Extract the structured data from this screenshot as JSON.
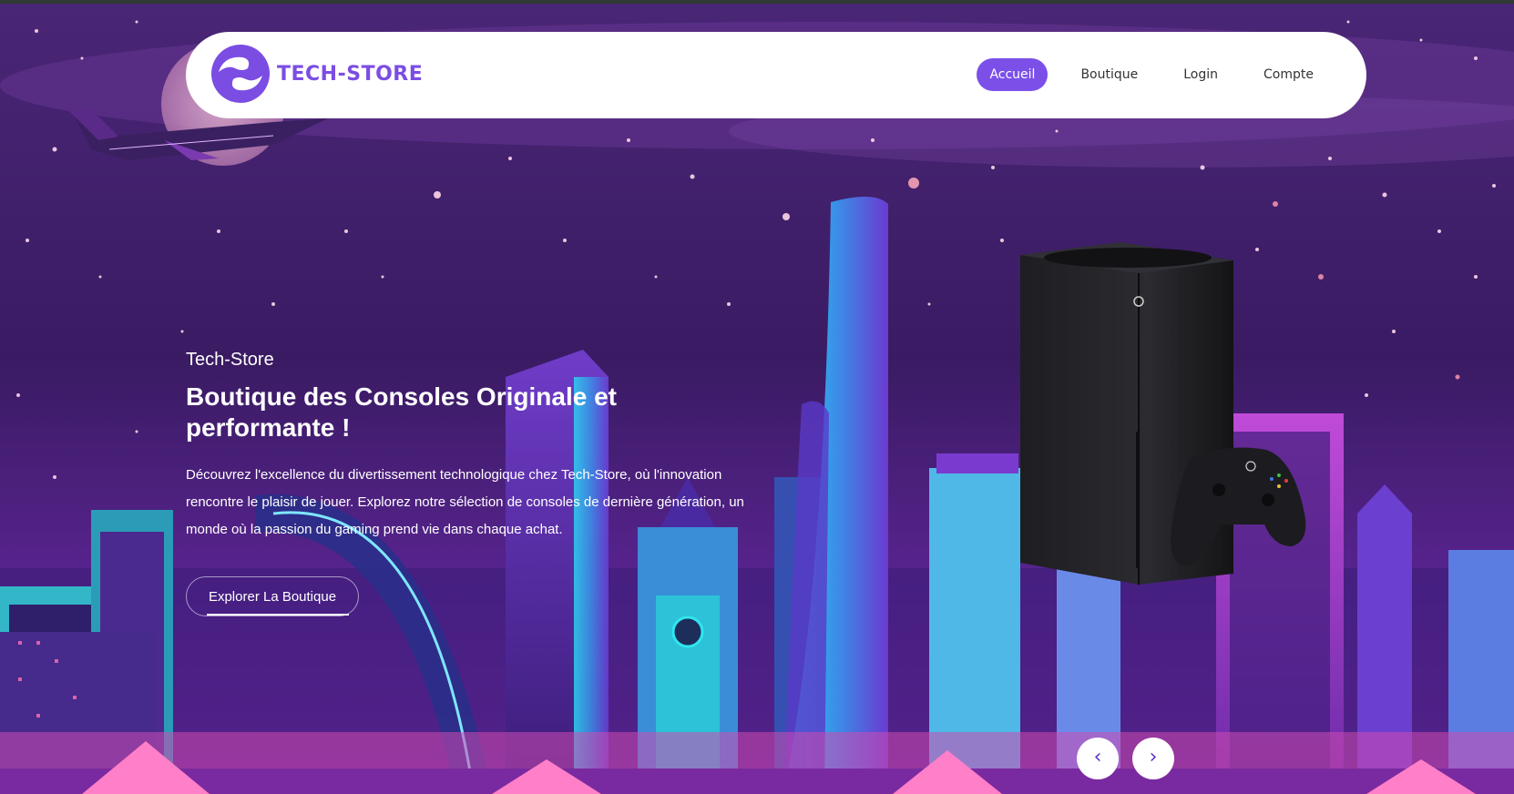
{
  "brand": {
    "name": "TECH-STORE",
    "color": "#7b4de3"
  },
  "nav": {
    "items": [
      {
        "label": "Accueil",
        "active": true
      },
      {
        "label": "Boutique",
        "active": false
      },
      {
        "label": "Login",
        "active": false
      },
      {
        "label": "Compte",
        "active": false
      }
    ],
    "active_color": "#7b4fe8"
  },
  "hero": {
    "eyebrow": "Tech-Store",
    "title": "Boutique des Consoles Originale et performante !",
    "description": "Découvrez l'excellence du divertissement technologique chez Tech-Store, où l'innovation rencontre le plaisir de jouer. Explorez notre sélection de consoles de dernière génération, un monde où la passion du gaming prend vie dans chaque achat.",
    "cta_label": "Explorer La Boutique",
    "image": "xbox-series-x-console-with-controller"
  },
  "carousel": {
    "prev_icon": "‹",
    "next_icon": "›"
  },
  "background": {
    "theme": "neon-city-night",
    "colors": [
      "#3a1a5e",
      "#7a2fb0",
      "#27e0f0",
      "#e83aa8"
    ]
  }
}
